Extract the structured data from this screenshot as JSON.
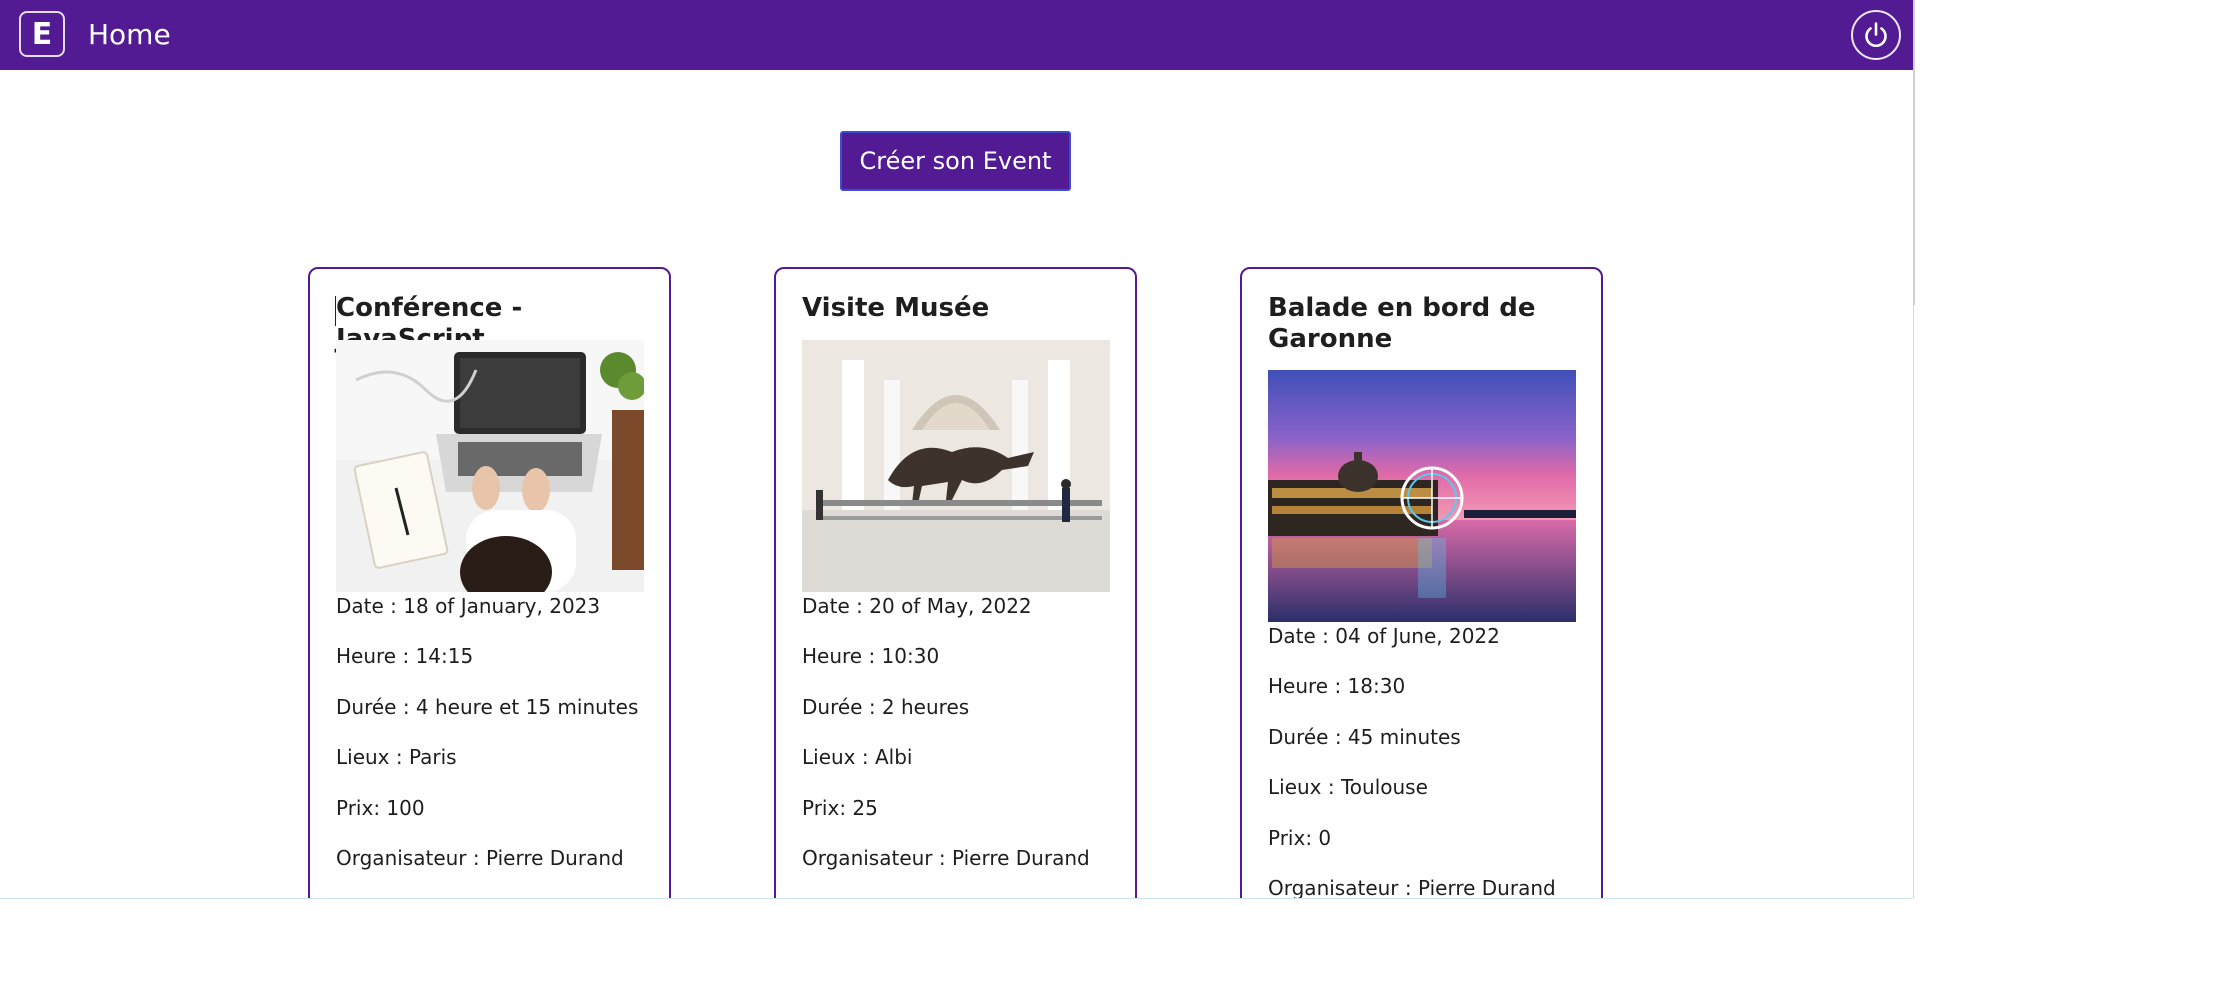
{
  "navbar": {
    "logo_letter": "E",
    "title": "Home",
    "power_icon": "power-icon"
  },
  "create_button_label": "Créer son Event",
  "colors": {
    "brand": "#521b93",
    "button_border": "#3a4fd0"
  },
  "events": [
    {
      "title": "Conférence - JavaScript",
      "image": "laptop-desk-photo",
      "date": "Date : 18 of January, 2023",
      "heure": "Heure : 14:15",
      "duree": "Durée : 4 heure et 15 minutes",
      "lieux": "Lieux : Paris",
      "prix": "Prix: 100",
      "organisateur": "Organisateur : Pierre Durand"
    },
    {
      "title": "Visite Musée",
      "image": "museum-dinosaur-photo",
      "date": "Date : 20 of May, 2022",
      "heure": "Heure : 10:30",
      "duree": "Durée : 2 heures",
      "lieux": "Lieux : Albi",
      "prix": "Prix: 25",
      "organisateur": "Organisateur : Pierre Durand"
    },
    {
      "title": "Balade en bord de Garonne",
      "image": "toulouse-riverside-sunset-photo",
      "date": "Date : 04 of June, 2022",
      "heure": "Heure : 18:30",
      "duree": "Durée : 45 minutes",
      "lieux": "Lieux : Toulouse",
      "prix": "Prix: 0",
      "organisateur": "Organisateur : Pierre Durand"
    }
  ]
}
